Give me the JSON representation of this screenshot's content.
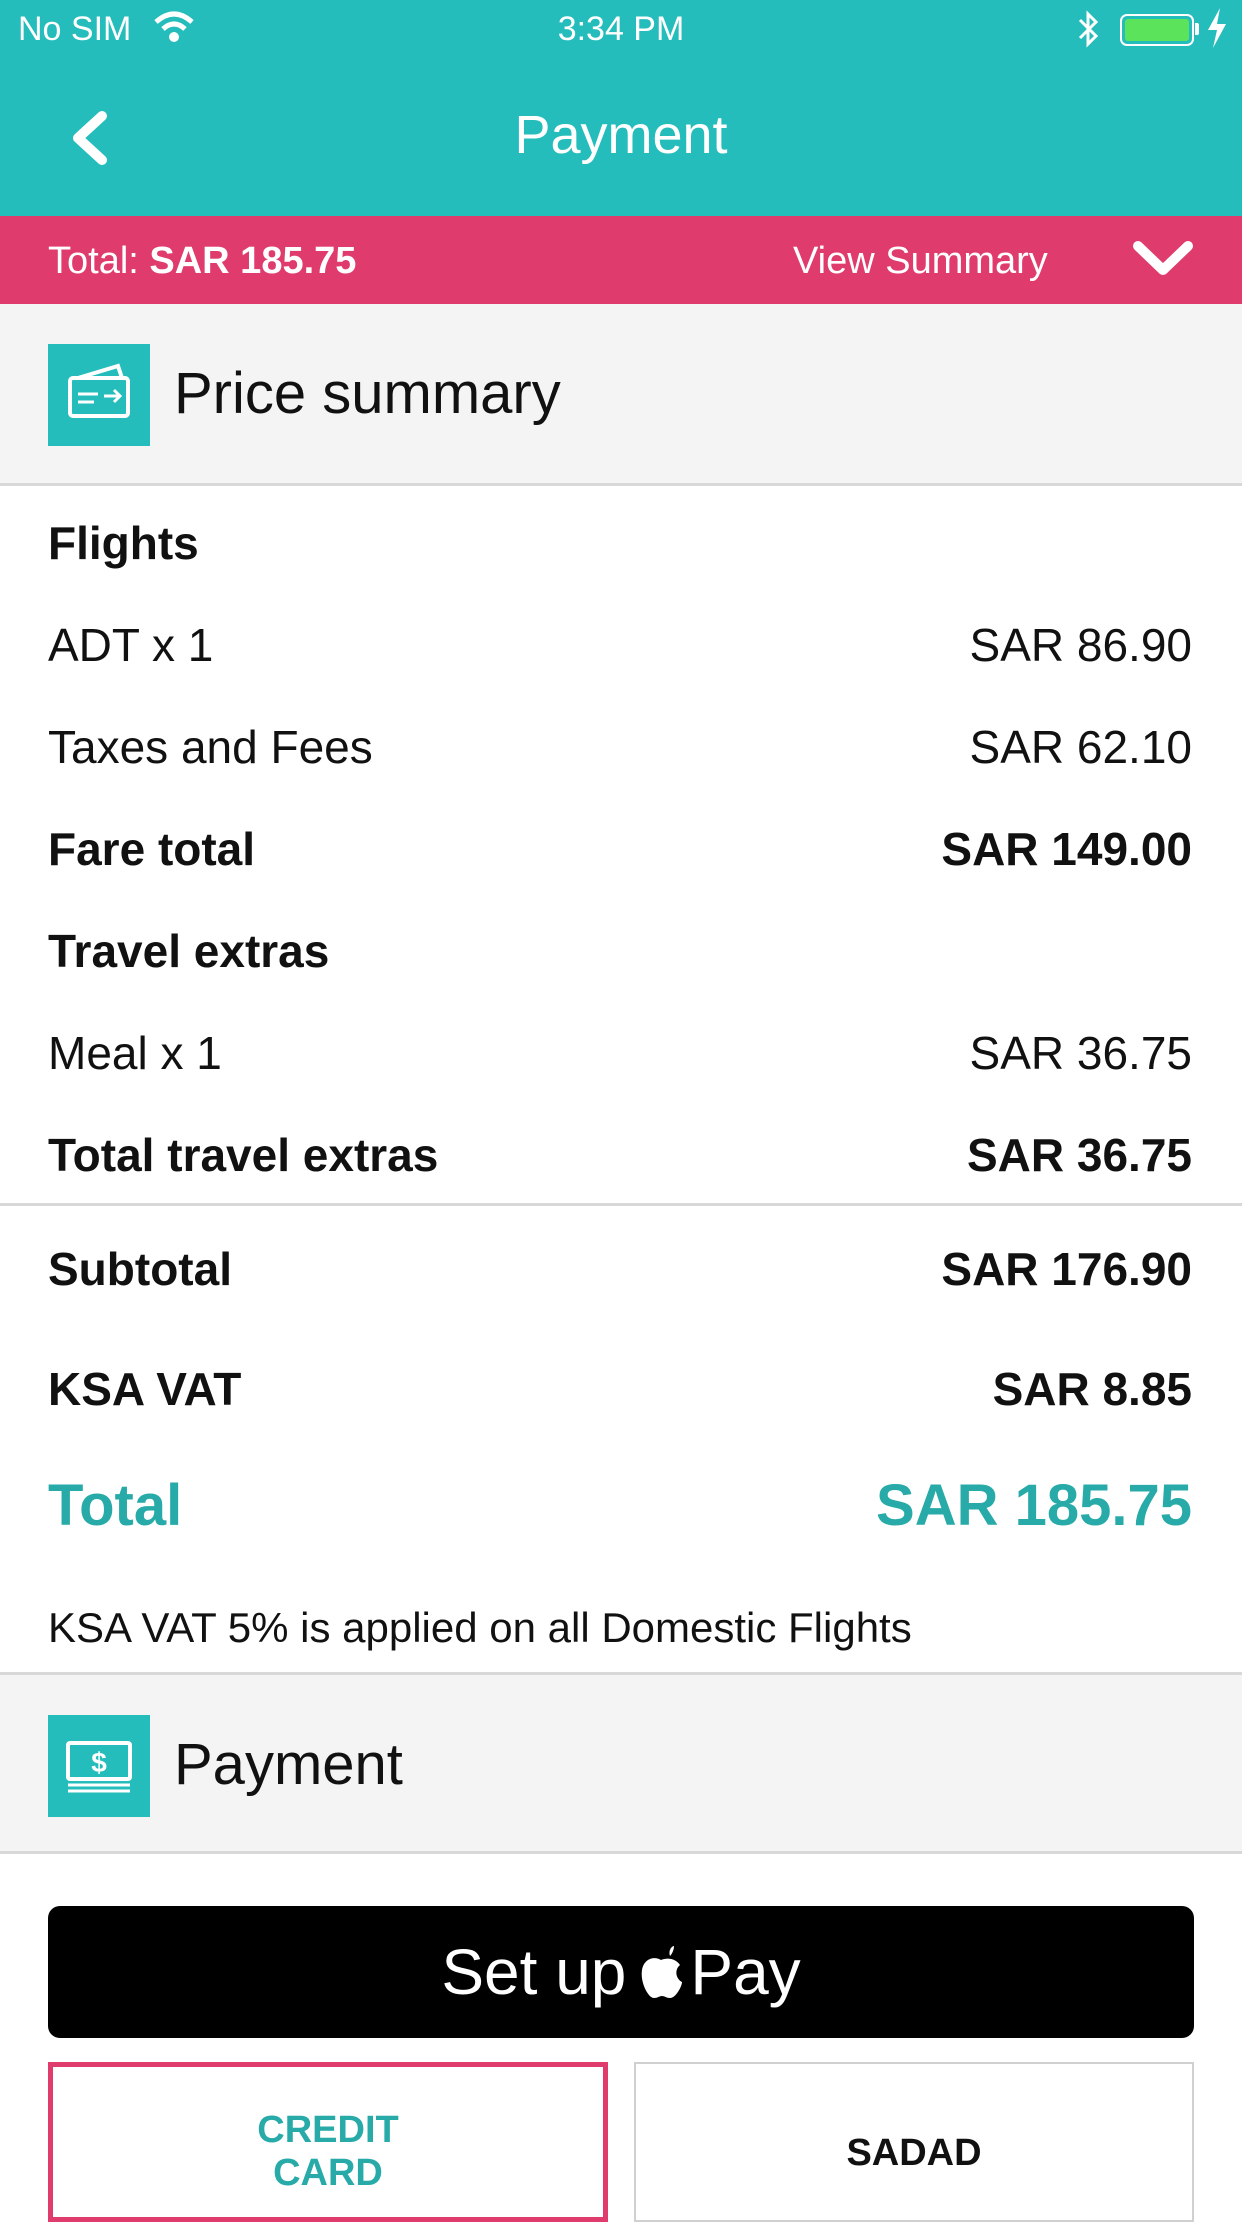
{
  "status_bar": {
    "carrier": "No SIM",
    "time": "3:34 PM"
  },
  "header": {
    "title": "Payment"
  },
  "total_bar": {
    "label": "Total:",
    "amount": "SAR 185.75",
    "view_summary": "View Summary"
  },
  "price_summary": {
    "title": "Price summary",
    "flights_heading": "Flights",
    "adt": {
      "label": "ADT x 1",
      "value": "SAR 86.90"
    },
    "taxes": {
      "label": "Taxes and Fees",
      "value": "SAR 62.10"
    },
    "fare_total": {
      "label": "Fare total",
      "value": "SAR 149.00"
    },
    "extras_heading": "Travel extras",
    "meal": {
      "label": "Meal x 1",
      "value": "SAR 36.75"
    },
    "extras_total": {
      "label": "Total travel extras",
      "value": "SAR 36.75"
    },
    "subtotal": {
      "label": "Subtotal",
      "value": "SAR 176.90"
    },
    "vat": {
      "label": "KSA VAT",
      "value": "SAR 8.85"
    },
    "total": {
      "label": "Total",
      "value": "SAR 185.75"
    },
    "vat_note": "KSA VAT 5% is applied on all Domestic Flights"
  },
  "payment": {
    "title": "Payment",
    "apple_pay": {
      "prefix": "Set up",
      "suffix": "Pay"
    },
    "tabs": [
      {
        "line1": "CREDIT",
        "line2": "CARD"
      },
      {
        "label": "SADAD"
      }
    ]
  },
  "colors": {
    "teal": "#24bdbb",
    "pink": "#e03b6d",
    "battery": "#5ce35c"
  }
}
